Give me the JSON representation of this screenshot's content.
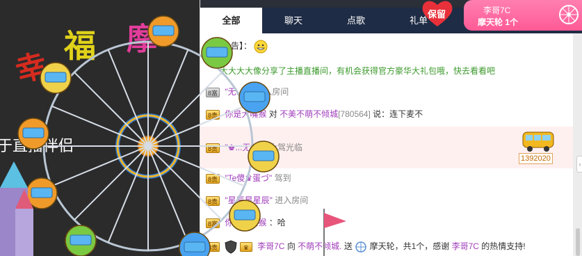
{
  "stage": {
    "text": "于直播伴侣",
    "fu_words": [
      "幸",
      "福",
      "摩"
    ]
  },
  "tabs": [
    {
      "label": "全部",
      "active": true
    },
    {
      "label": "聊天",
      "active": false
    },
    {
      "label": "点歌",
      "active": false
    },
    {
      "label": "礼单",
      "active": false
    }
  ],
  "gift_banner": {
    "keep_label": "保留",
    "user": "李哥7C",
    "gift_line": "摩天轮 1个"
  },
  "messages": [
    {
      "prefix": "公告】：",
      "text": ""
    },
    {
      "text": "大大大大像分享了主播直播间，有机会获得官方豪华大礼包哦，快去看看吧"
    },
    {
      "badge": "8富",
      "nick": "\"无...2t\"",
      "text": "进入房间"
    },
    {
      "badge": "8贵",
      "nick": "你是大嘴猴",
      "mid": "对",
      "target": "不美不萌不倾城",
      "id": "[780564]",
      "text": "说：连下麦不"
    },
    {
      "badge": "8贵",
      "nick": "\"♚...无痕~\"",
      "text": "大驾光临",
      "gift_count": "1392020"
    },
    {
      "badge": "8贵",
      "nick": "\"Te傻♛蛋づ\"",
      "text": "驾到"
    },
    {
      "badge": "8贵",
      "nick": "\"星辰星星辰\"",
      "text": "进入房间"
    },
    {
      "badge": "8富",
      "nick": "你是大嘴猴",
      "text": "：哈"
    },
    {
      "badge": "8贵",
      "nick": "李哥7C",
      "mid": "向",
      "target": "不萌不倾城.",
      "text": "送",
      "gift": "摩天轮，共1个，感谢",
      "thanks": "李哥7C",
      "tail": "的热情支持!"
    }
  ],
  "colors": {
    "tab_bar": "#1f2c45",
    "gift_pink": "#ff5a96",
    "nick_purple": "#a03dbb"
  }
}
